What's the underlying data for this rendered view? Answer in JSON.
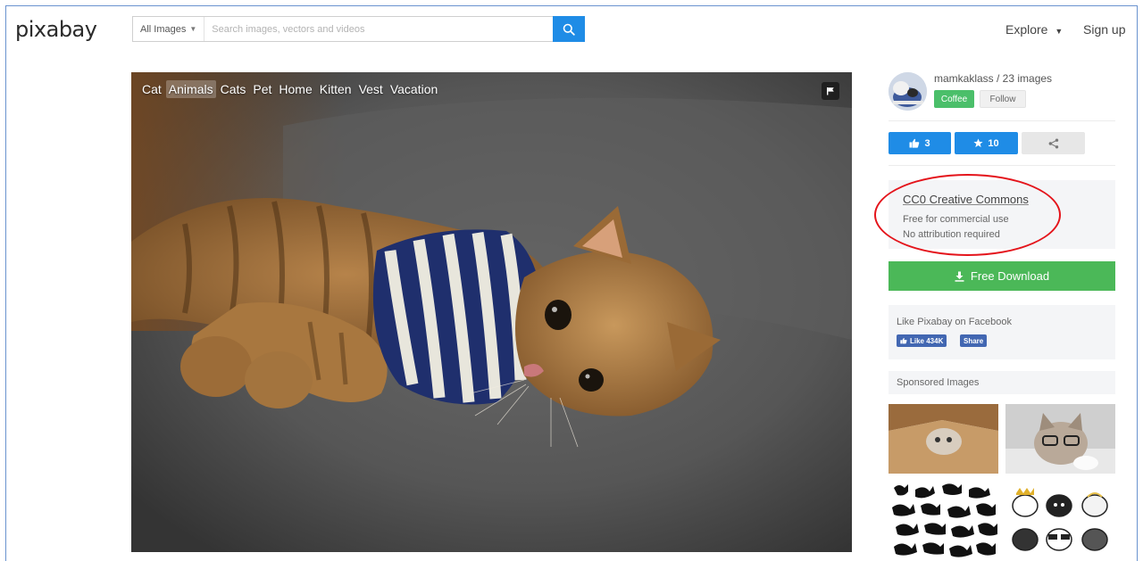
{
  "header": {
    "logo": "pixabay",
    "search_filter": "All Images",
    "search_placeholder": "Search images, vectors and videos",
    "nav_explore": "Explore",
    "nav_signup": "Sign up"
  },
  "photo": {
    "tags": [
      {
        "label": "Cat",
        "active": false
      },
      {
        "label": "Animals",
        "active": true
      },
      {
        "label": "Cats",
        "active": false
      },
      {
        "label": "Pet",
        "active": false
      },
      {
        "label": "Home",
        "active": false
      },
      {
        "label": "Kitten",
        "active": false
      },
      {
        "label": "Vest",
        "active": false
      },
      {
        "label": "Vacation",
        "active": false
      }
    ]
  },
  "sidebar": {
    "author": "mamkaklass / 23 images",
    "coffee_label": "Coffee",
    "follow_label": "Follow",
    "likes": "3",
    "favorites": "10",
    "license_title": "CC0 Creative Commons",
    "license_line1": "Free for commercial use",
    "license_line2": "No attribution required",
    "download_label": "Free Download",
    "facebook_title": "Like Pixabay on Facebook",
    "fb_like_label": "Like 434K",
    "fb_share_label": "Share",
    "sponsored_label": "Sponsored Images"
  },
  "colors": {
    "accent_blue": "#1f8ce6",
    "download_green": "#4bb858",
    "annotation_red": "#e4141b",
    "facebook_blue": "#4267b2"
  }
}
